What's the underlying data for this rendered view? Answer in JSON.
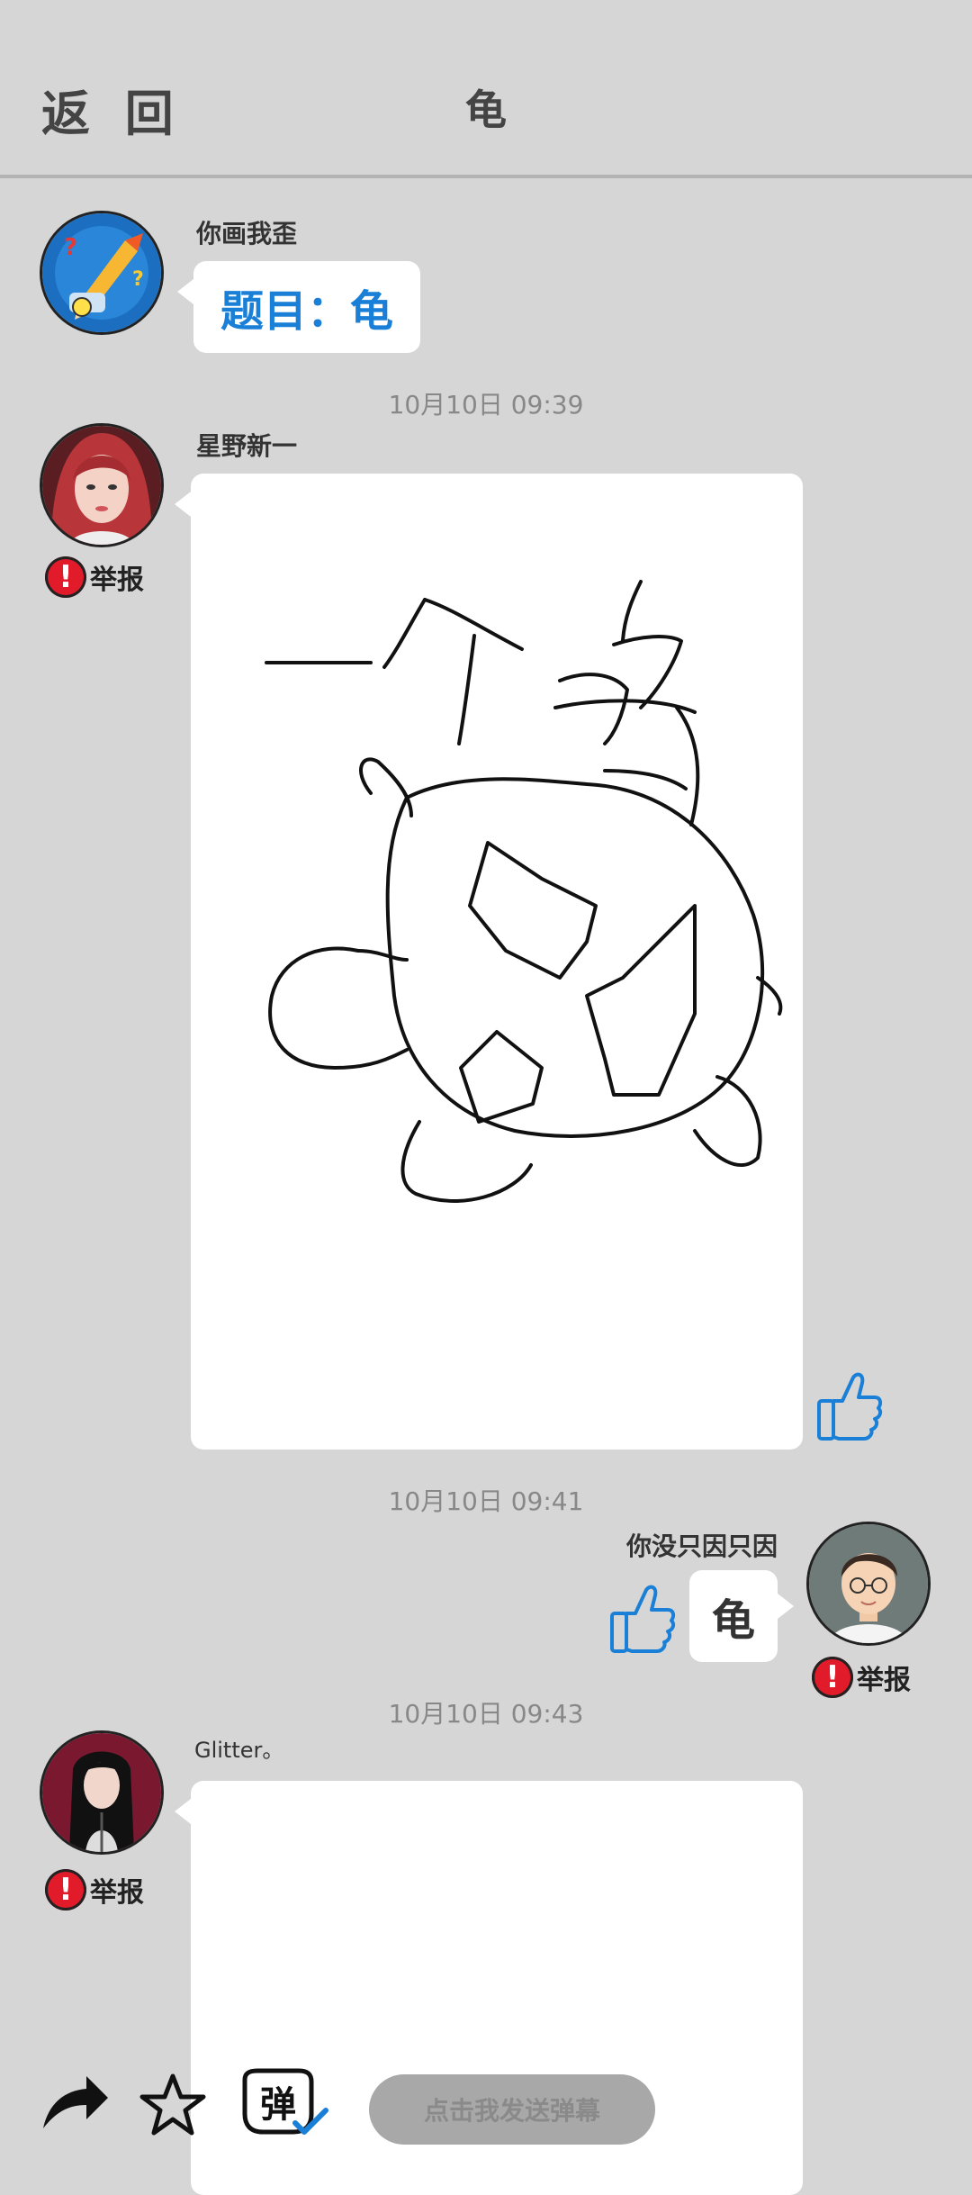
{
  "header": {
    "back_label": "返 回",
    "title": "龟"
  },
  "messages": [
    {
      "user": "你画我歪",
      "topic_label": "题目：龟"
    },
    {
      "time": "10月10日  09:39",
      "user": "星野新一",
      "report_label": "举报"
    },
    {
      "time": "10月10日  09:41",
      "user": "你没只因只因",
      "guess": "龟",
      "report_label": "举报"
    },
    {
      "time": "10月10日  09:43",
      "user": "Glitter。",
      "report_label": "举报"
    }
  ],
  "bottom_bar": {
    "danmaku_placeholder": "点击我发送弹幕",
    "danmaku_icon_char": "弹"
  },
  "icons": {
    "like": "thumbs-up-icon",
    "report": "exclamation-icon",
    "share": "share-arrow-icon",
    "favorite": "star-icon",
    "danmaku": "danmaku-icon"
  },
  "colors": {
    "background": "#d6d6d6",
    "accent_blue": "#1a7fd6",
    "report_red": "#e11b2a",
    "input_bg": "#a8a8a8"
  }
}
